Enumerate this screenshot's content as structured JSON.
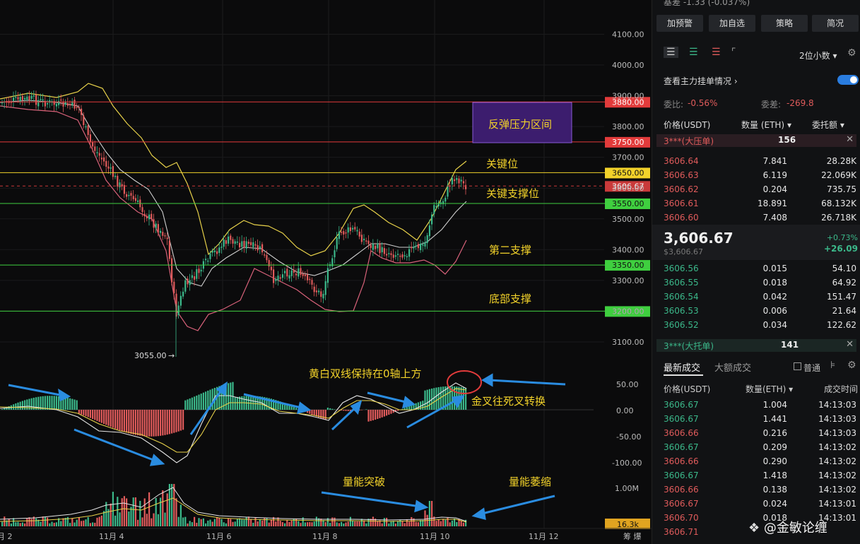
{
  "chart": {
    "y_labels": [
      "4100.00",
      "4000.00",
      "3900.00",
      "3800.00",
      "3700.00",
      "3600.00",
      "3500.00",
      "3400.00",
      "3300.00",
      "3200.00",
      "3100.00"
    ],
    "x_labels": [
      "月 2",
      "11月 4",
      "11月 6",
      "11月 8",
      "11月 10",
      "11月 12",
      "筹 爆"
    ],
    "levels": [
      {
        "value": "3880.00",
        "color": "#e23b3b"
      },
      {
        "value": "3750.00",
        "color": "#e23b3b"
      },
      {
        "value": "3650.00",
        "color": "#f2d22a"
      },
      {
        "value": "3606.67",
        "color": "#c93a3a"
      },
      {
        "value": "3550.00",
        "color": "#3fcf3f"
      },
      {
        "value": "3350.00",
        "color": "#3fcf3f"
      },
      {
        "value": "3200.00",
        "color": "#3fcf3f"
      }
    ],
    "annotations": {
      "resistance_zone": "反弹压力区间",
      "key_level": "关键位",
      "key_support": "关键支撑位",
      "second_support": "第二支撑",
      "bottom_support": "底部支撑",
      "low_marker": "3055.00",
      "macd_note": "黄白双线保持在0轴上方",
      "cross_note": "金叉往死叉转换",
      "vol_break": "量能突破",
      "vol_shrink": "量能萎缩"
    },
    "macd_labels": [
      "50.00",
      "0.00",
      "-50.00",
      "-100.00"
    ],
    "vol_labels": [
      "1.00M",
      "16.3k"
    ]
  },
  "side": {
    "top_partial": "基差    -1.33 (-0.037%)",
    "buttons": [
      "加预警",
      "加自选",
      "策略",
      "简况"
    ],
    "decimals": "2位小数",
    "main_orders": "查看主力挂单情况",
    "ratio_label": "委比:",
    "ratio_value": "-0.56%",
    "diff_label": "委差:",
    "diff_value": "-269.8",
    "col_price": "价格(USDT)",
    "col_qty": "数量 (ETH)",
    "col_total": "委托额",
    "ask_banner": {
      "label": "3***(大压单)",
      "value": "156"
    },
    "asks": [
      {
        "p": "3606.64",
        "q": "7.841",
        "t": "28.28K"
      },
      {
        "p": "3606.63",
        "q": "6.119",
        "t": "22.069K"
      },
      {
        "p": "3606.62",
        "q": "0.204",
        "t": "735.75"
      },
      {
        "p": "3606.61",
        "q": "18.891",
        "t": "68.132K"
      },
      {
        "p": "3606.60",
        "q": "7.408",
        "t": "26.718K"
      }
    ],
    "last_price": "3,606.67",
    "last_sub": "$3,606.67",
    "change_pct": "+0.73%",
    "change_abs": "+26.09",
    "bids": [
      {
        "p": "3606.56",
        "q": "0.015",
        "t": "54.10"
      },
      {
        "p": "3606.55",
        "q": "0.018",
        "t": "64.92"
      },
      {
        "p": "3606.54",
        "q": "0.042",
        "t": "151.47"
      },
      {
        "p": "3606.53",
        "q": "0.006",
        "t": "21.64"
      },
      {
        "p": "3606.52",
        "q": "0.034",
        "t": "122.62"
      }
    ],
    "bid_banner": {
      "label": "3***(大托单)",
      "value": "141"
    },
    "tab_latest": "最新成交",
    "tab_big": "大额成交",
    "normal": "普通",
    "trade_col_price": "价格(USDT)",
    "trade_col_qty": "数量(ETH)",
    "trade_col_time": "成交时间",
    "trades": [
      {
        "p": "3606.67",
        "q": "1.004",
        "t": "14:13:03",
        "c": "green"
      },
      {
        "p": "3606.67",
        "q": "1.441",
        "t": "14:13:03",
        "c": "green"
      },
      {
        "p": "3606.66",
        "q": "0.216",
        "t": "14:13:03",
        "c": "red"
      },
      {
        "p": "3606.67",
        "q": "0.209",
        "t": "14:13:02",
        "c": "green"
      },
      {
        "p": "3606.66",
        "q": "0.290",
        "t": "14:13:02",
        "c": "red"
      },
      {
        "p": "3606.67",
        "q": "1.418",
        "t": "14:13:02",
        "c": "green"
      },
      {
        "p": "3606.66",
        "q": "0.138",
        "t": "14:13:02",
        "c": "red"
      },
      {
        "p": "3606.67",
        "q": "0.024",
        "t": "14:13:01",
        "c": "red"
      },
      {
        "p": "3606.70",
        "q": "0.018",
        "t": "14:13:01",
        "c": "red"
      },
      {
        "p": "3606.71",
        "q": "",
        "t": "",
        "c": "red"
      }
    ],
    "watermark": "@金敏论缠"
  }
}
